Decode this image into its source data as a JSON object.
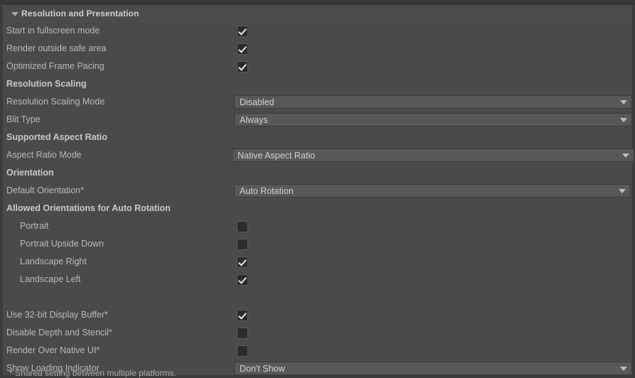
{
  "panel": {
    "title": "Resolution and Presentation",
    "foldout_expanded": true,
    "foldout_icon": "triangle-down-icon"
  },
  "colors": {
    "window_background": "#3c3c3c",
    "panel_background": "#4a4a4a",
    "header_background": "#4b4b4b",
    "label_text": "#b9b9b9",
    "section_text": "#c8c8c8",
    "dropdown_background": "#585858",
    "dropdown_text": "#d2d2d2",
    "checkbox_background": "#2c2c2c",
    "checkmark": "#e8e8e8"
  },
  "rows": [
    {
      "label": "Start in fullscreen mode",
      "type": "checkbox",
      "checked": true,
      "indent": 0
    },
    {
      "label": "Render outside safe area",
      "type": "checkbox",
      "checked": true,
      "indent": 0
    },
    {
      "label": "Optimized Frame Pacing",
      "type": "checkbox",
      "checked": true,
      "indent": 0
    },
    {
      "label": "Resolution Scaling",
      "type": "section",
      "indent": 0
    },
    {
      "label": "Resolution Scaling Mode",
      "type": "dropdown",
      "value": "Disabled",
      "indent": 0,
      "variant": "dd-a"
    },
    {
      "label": "Blit Type",
      "type": "dropdown",
      "value": "Always",
      "indent": 0,
      "variant": "dd-a"
    },
    {
      "label": "Supported Aspect Ratio",
      "type": "section",
      "indent": 0
    },
    {
      "label": "Aspect Ratio Mode",
      "type": "dropdown",
      "value": "Native Aspect Ratio",
      "indent": 0,
      "variant": "dd-b"
    },
    {
      "label": "Orientation",
      "type": "section",
      "indent": 0
    },
    {
      "label": "Default Orientation*",
      "type": "dropdown",
      "value": "Auto Rotation",
      "indent": 0,
      "variant": "dd-c"
    },
    {
      "label": "Allowed Orientations for Auto Rotation",
      "type": "section",
      "indent": 0
    },
    {
      "label": "Portrait",
      "type": "checkbox",
      "checked": false,
      "indent": 1
    },
    {
      "label": "Portrait Upside Down",
      "type": "checkbox",
      "checked": false,
      "indent": 1
    },
    {
      "label": "Landscape Right",
      "type": "checkbox",
      "checked": true,
      "indent": 1
    },
    {
      "label": "Landscape Left",
      "type": "checkbox",
      "checked": true,
      "indent": 1
    },
    {
      "label": "",
      "type": "spacer",
      "indent": 0
    },
    {
      "label": "Use 32-bit Display Buffer*",
      "type": "checkbox",
      "checked": true,
      "indent": 0
    },
    {
      "label": "Disable Depth and Stencil*",
      "type": "checkbox",
      "checked": false,
      "indent": 0
    },
    {
      "label": "Render Over Native UI*",
      "type": "checkbox",
      "checked": false,
      "indent": 0
    },
    {
      "label": "Show Loading Indicator",
      "type": "dropdown",
      "value": "Don't Show",
      "indent": 0,
      "variant": "dd-d"
    }
  ],
  "footnote": "* Shared setting between multiple platforms."
}
